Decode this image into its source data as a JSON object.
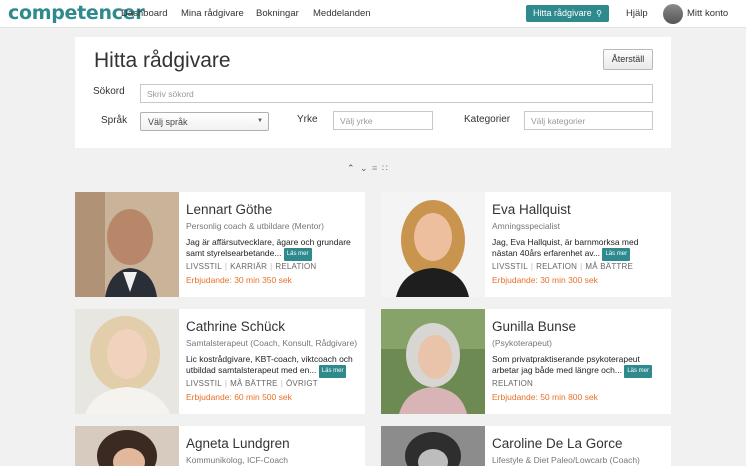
{
  "nav": {
    "logo": "competencer",
    "links": [
      "Dashboard",
      "Mina rådgivare",
      "Bokningar",
      "Meddelanden"
    ],
    "find_button": "Hitta rådgivare",
    "help": "Hjälp",
    "account": "Mitt konto"
  },
  "search": {
    "title": "Hitta rådgivare",
    "reset": "Återställ",
    "keyword_label": "Sökord",
    "keyword_placeholder": "Skriv sökord",
    "language_label": "Språk",
    "language_value": "Välj språk",
    "profession_label": "Yrke",
    "profession_placeholder": "Välj yrke",
    "category_label": "Kategorier",
    "category_placeholder": "Välj kategorier"
  },
  "read_more": "Läs mer",
  "advisors": [
    {
      "name": "Lennart Göthe",
      "role": "Personlig coach & utbildare (Mentor)",
      "desc": "Jag är affärsutvecklare, ägare och grundare samt styrelsearbetande...",
      "tags": [
        "LIVSSTIL",
        "KARRIÄR",
        "RELATION"
      ],
      "price": "Erbjudande: 30 min 350 sek"
    },
    {
      "name": "Eva Hallquist",
      "role": "Amningsspecialist",
      "desc": "Jag, Eva Hallquist, är barnmorksa med nästan 40års erfarenhet av...",
      "tags": [
        "LIVSSTIL",
        "RELATION",
        "MÅ BÄTTRE"
      ],
      "price": "Erbjudande: 30 min 300 sek"
    },
    {
      "name": "Cathrine Schück",
      "role": "Samtalsterapeut (Coach, Konsult, Rådgivare)",
      "desc": "Lic kostrådgivare, KBT-coach, viktcoach och utbildad samtalsterapeut med en...",
      "tags": [
        "LIVSSTIL",
        "MÅ BÄTTRE",
        "ÖVRIGT"
      ],
      "price": "Erbjudande: 60 min 500 sek"
    },
    {
      "name": "Gunilla Bunse",
      "role": "(Psykoterapeut)",
      "desc": "Som privatpraktiserande psykoterapeut arbetar jag både med längre och...",
      "tags": [
        "RELATION"
      ],
      "price": "Erbjudande: 50 min 800 sek"
    },
    {
      "name": "Agneta Lundgren",
      "role": "Kommunikolog, ICF-Coach",
      "desc": "",
      "tags": [],
      "price": ""
    },
    {
      "name": "Caroline De La Gorce",
      "role": "Lifestyle & Diet Paleo/Lowcarb (Coach)",
      "desc": "",
      "tags": [],
      "price": ""
    }
  ],
  "colors": {
    "brand": "#2f8a8e",
    "price": "#e8712a"
  }
}
